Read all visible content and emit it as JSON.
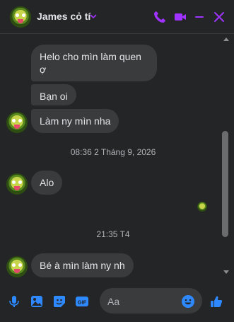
{
  "header": {
    "contact_name": "James cỏ tí",
    "icons": [
      "avatar",
      "chevron-down-icon",
      "phone-icon",
      "video-icon",
      "minimize-icon",
      "close-icon"
    ]
  },
  "messages": [
    {
      "id": "m1",
      "text_line1": "Helo cho mìn làm quen",
      "text_line2": "ợ"
    },
    {
      "id": "m2",
      "text": "Bạn oi"
    },
    {
      "id": "m3",
      "text": "Làm ny mìn nha"
    },
    {
      "id": "t1",
      "timestamp": "08:36 2 Tháng 9, 2026"
    },
    {
      "id": "m4",
      "text": "Alo"
    },
    {
      "id": "t2",
      "timestamp": "21:35 T4"
    },
    {
      "id": "m5",
      "text": "Bé à mìn làm ny nh"
    }
  ],
  "composer": {
    "placeholder": "Aa",
    "icons": [
      "mic-icon",
      "image-icon",
      "sticker-icon",
      "gif-icon",
      "emoji-icon",
      "like-icon"
    ]
  },
  "colors": {
    "accent": "#a033ff",
    "blue": "#2e89ff",
    "background": "#242526",
    "bubble": "#3a3b3c"
  }
}
